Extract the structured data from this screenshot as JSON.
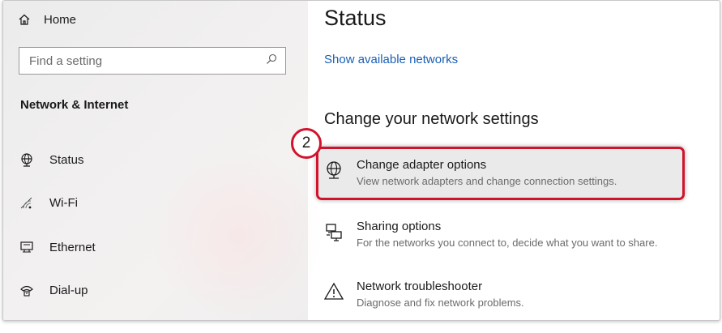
{
  "sidebar": {
    "home_label": "Home",
    "search_placeholder": "Find a setting",
    "section_title": "Network & Internet",
    "items": [
      {
        "label": "Status",
        "icon": "globe-icon"
      },
      {
        "label": "Wi-Fi",
        "icon": "wifi-icon"
      },
      {
        "label": "Ethernet",
        "icon": "ethernet-icon"
      },
      {
        "label": "Dial-up",
        "icon": "phone-icon"
      }
    ]
  },
  "main": {
    "title": "Status",
    "show_networks_link": "Show available networks",
    "section_title": "Change your network settings",
    "options": [
      {
        "title": "Change adapter options",
        "desc": "View network adapters and change connection settings.",
        "icon": "globe-icon"
      },
      {
        "title": "Sharing options",
        "desc": "For the networks you connect to, decide what you want to share.",
        "icon": "share-icon"
      },
      {
        "title": "Network troubleshooter",
        "desc": "Diagnose and fix network problems.",
        "icon": "warning-icon"
      }
    ]
  },
  "annotation": {
    "step_number": "2",
    "highlight_color": "#d1132b"
  },
  "colors": {
    "link": "#1a5fb4",
    "sidebar_bg": "#efeeee"
  }
}
